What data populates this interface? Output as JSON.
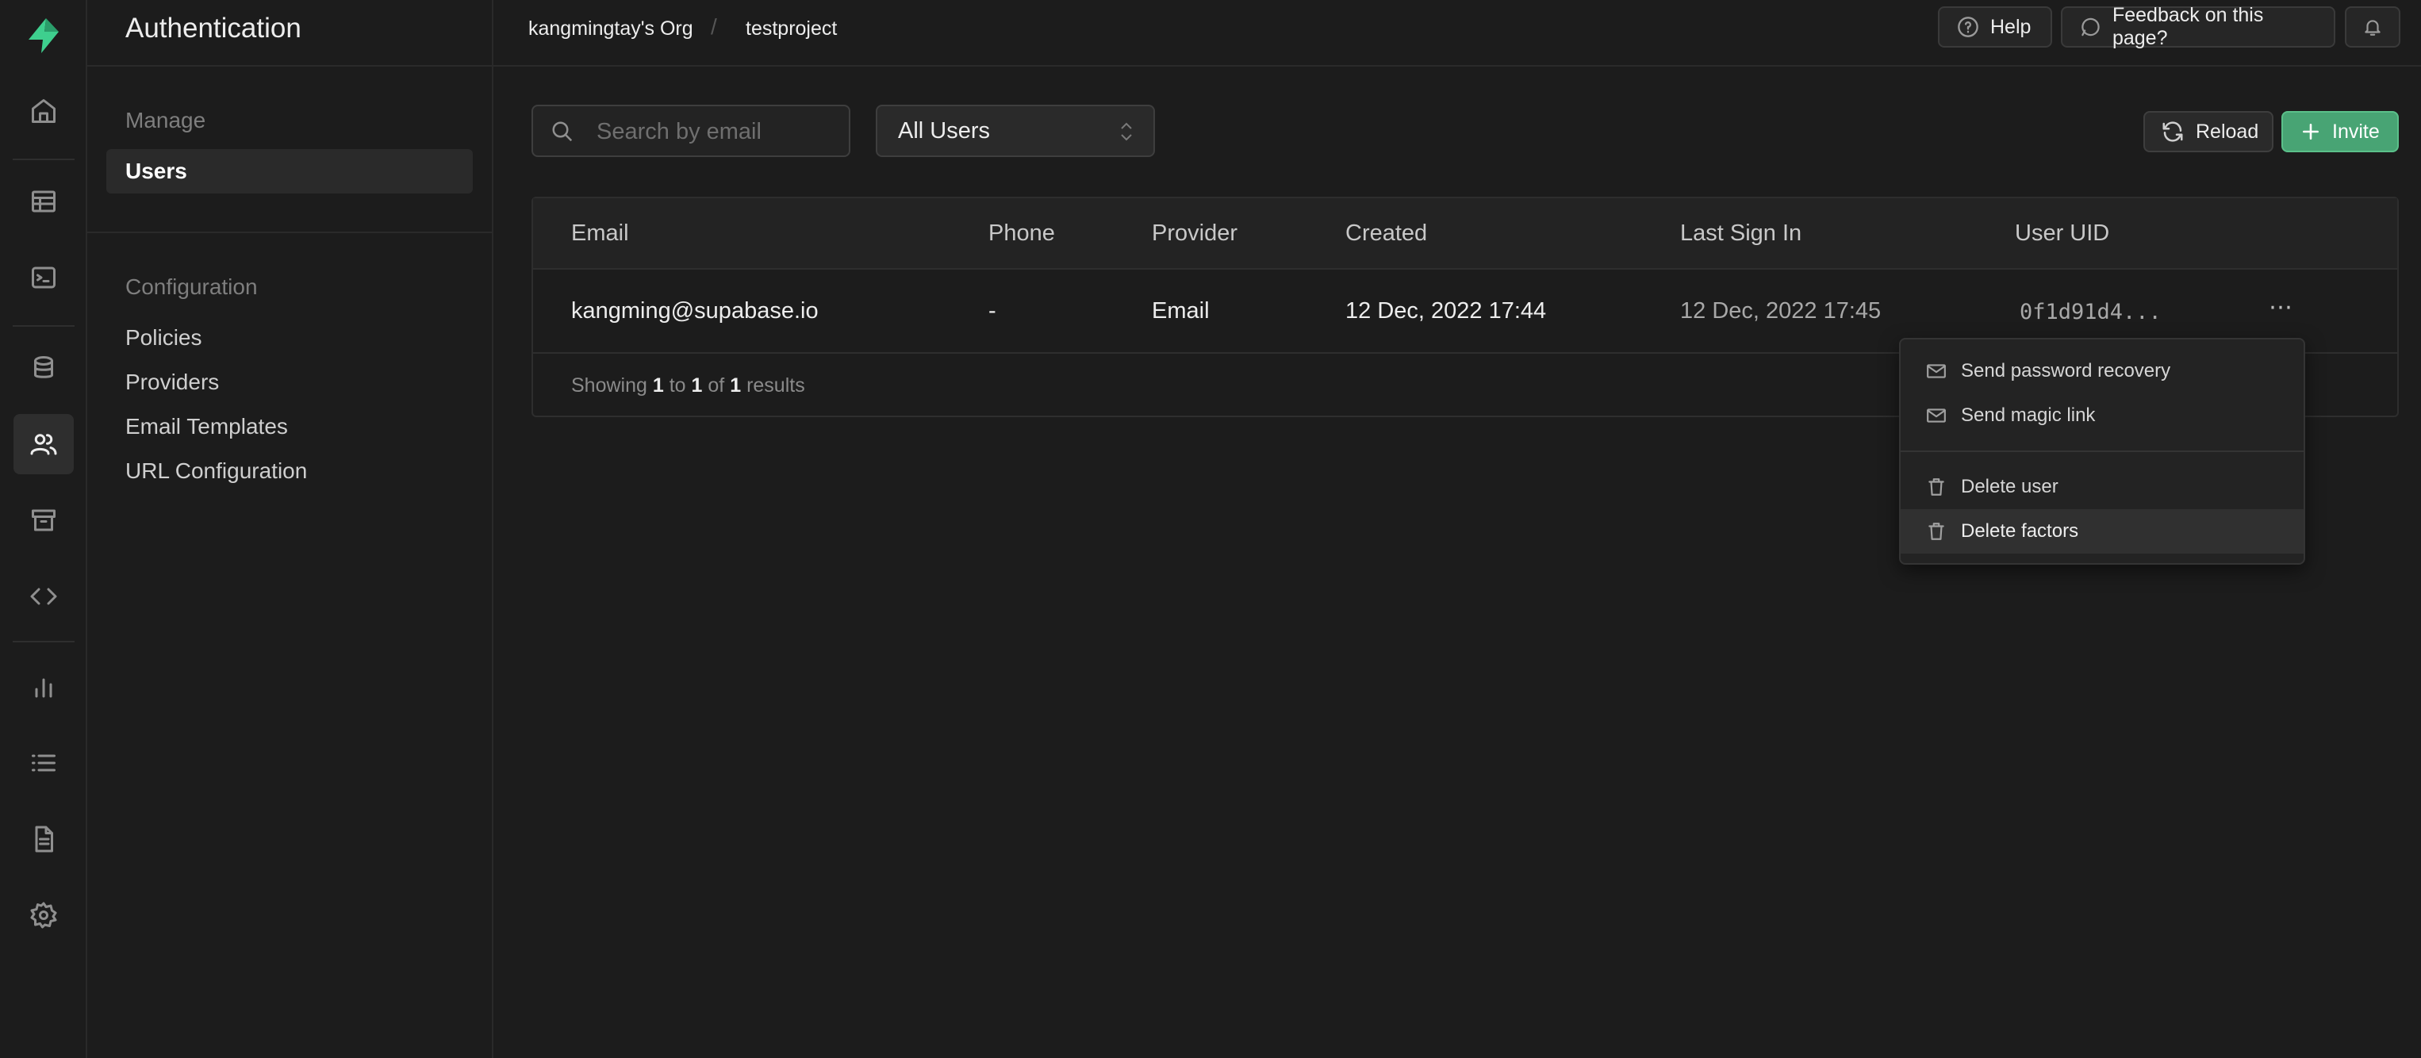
{
  "rail": {
    "icons": [
      "home-icon",
      "table-editor-icon",
      "sql-editor-icon",
      "database-icon",
      "authentication-icon",
      "storage-icon",
      "edge-functions-icon",
      "reports-icon",
      "logs-icon",
      "api-docs-icon",
      "settings-icon"
    ],
    "active": "authentication-icon",
    "accent": "#3ecf8e"
  },
  "menu": {
    "title": "Authentication",
    "manage_label": "Manage",
    "users_label": "Users",
    "config_label": "Configuration",
    "config_items": [
      "Policies",
      "Providers",
      "Email Templates",
      "URL Configuration"
    ]
  },
  "topbar": {
    "org": "kangmingtay's Org",
    "separator": "/",
    "project": "testproject",
    "help_label": "Help",
    "feedback_label": "Feedback on this page?"
  },
  "toolbar": {
    "search_placeholder": "Search by email",
    "filter_value": "All Users",
    "reload_label": "Reload",
    "invite_label": "Invite"
  },
  "table": {
    "columns": [
      "Email",
      "Phone",
      "Provider",
      "Created",
      "Last Sign In",
      "User UID"
    ],
    "rows": [
      {
        "email": "kangming@supabase.io",
        "phone": "-",
        "provider": "Email",
        "created": "12 Dec, 2022 17:44",
        "last_sign_in": "12 Dec, 2022 17:45",
        "uid": "0f1d91d4..."
      }
    ],
    "row_actions_label": "⋯",
    "footer": {
      "showing": "Showing",
      "from": "1",
      "to_word": "to",
      "to": "1",
      "of_word": "of",
      "total": "1",
      "results": "results"
    }
  },
  "dropdown": {
    "items": [
      "Send password recovery",
      "Send magic link",
      "Delete user",
      "Delete factors"
    ],
    "highlighted": "Delete factors"
  },
  "colors": {
    "background": "#1c1c1c",
    "brand_green": "#48a474"
  }
}
